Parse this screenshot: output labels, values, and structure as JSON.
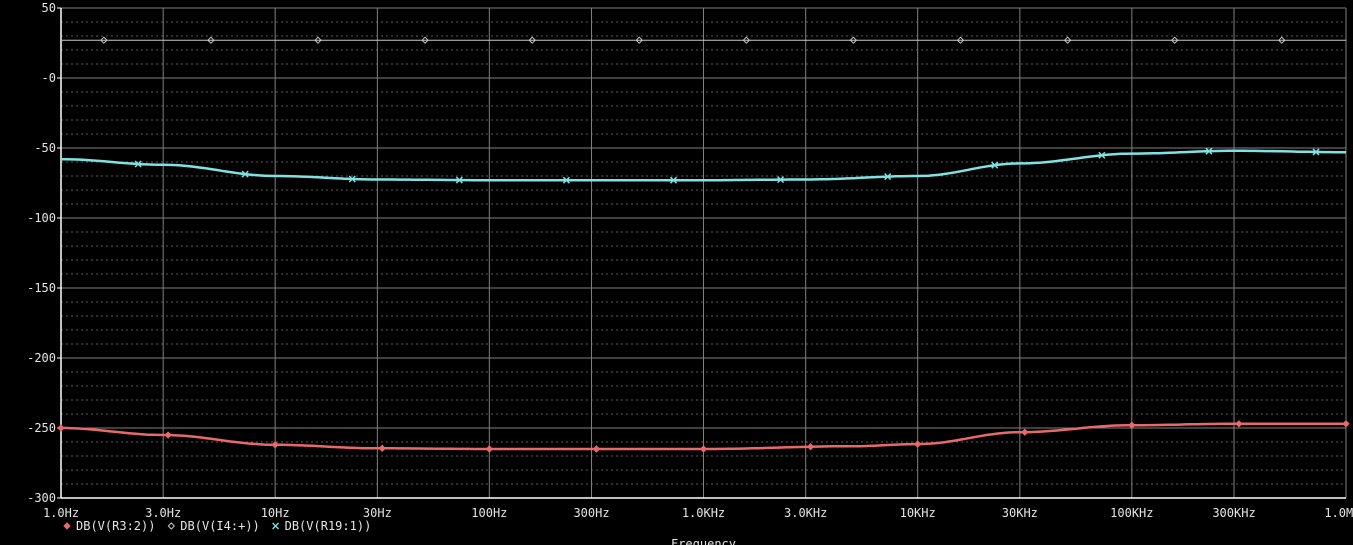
{
  "chart_data": {
    "type": "line",
    "xscale": "log",
    "xlabel": "Frequency",
    "ylabel": "",
    "xlim": [
      1,
      1000000
    ],
    "ylim": [
      -300,
      50
    ],
    "grid": true,
    "background": "#000000",
    "grid_color": "#808080",
    "axis_color": "#ffffff",
    "x_ticks": [
      {
        "value": 1,
        "label": "1.0Hz"
      },
      {
        "value": 3,
        "label": "3.0Hz"
      },
      {
        "value": 10,
        "label": "10Hz"
      },
      {
        "value": 30,
        "label": "30Hz"
      },
      {
        "value": 100,
        "label": "100Hz"
      },
      {
        "value": 300,
        "label": "300Hz"
      },
      {
        "value": 1000,
        "label": "1.0KHz"
      },
      {
        "value": 3000,
        "label": "3.0KHz"
      },
      {
        "value": 10000,
        "label": "10KHz"
      },
      {
        "value": 30000,
        "label": "30KHz"
      },
      {
        "value": 100000,
        "label": "100KHz"
      },
      {
        "value": 300000,
        "label": "300KHz"
      },
      {
        "value": 1000000,
        "label": "1.0MHz"
      }
    ],
    "y_ticks": [
      {
        "value": 50,
        "label": "50"
      },
      {
        "value": 0,
        "label": "-0"
      },
      {
        "value": -50,
        "label": "-50"
      },
      {
        "value": -100,
        "label": "-100"
      },
      {
        "value": -150,
        "label": "-150"
      },
      {
        "value": -200,
        "label": "-200"
      },
      {
        "value": -250,
        "label": "-250"
      },
      {
        "value": -300,
        "label": "-300"
      }
    ],
    "series": [
      {
        "name": "DB(V(R3:2))",
        "marker": "diamond",
        "color": "#e8696b",
        "x": [
          1,
          3,
          10,
          30,
          100,
          1000,
          5000,
          10000,
          30000,
          100000,
          300000,
          1000000
        ],
        "y": [
          -250,
          -255,
          -262,
          -264.5,
          -265,
          -265,
          -263,
          -261.5,
          -253,
          -248,
          -247,
          -247
        ]
      },
      {
        "name": "DB(V(I4:+))",
        "marker": "diamond",
        "color": "#c8c8c8",
        "x": [
          1,
          1000000
        ],
        "y": [
          27,
          27
        ]
      },
      {
        "name": "DB(V(R19:1))",
        "marker": "x",
        "color": "#7fe3e3",
        "x": [
          1,
          3,
          10,
          30,
          100,
          1000,
          3000,
          10000,
          30000,
          100000,
          300000,
          1000000
        ],
        "y": [
          -58,
          -62,
          -70,
          -72.5,
          -73,
          -73,
          -72.5,
          -70,
          -61,
          -54,
          -52,
          -53
        ]
      }
    ]
  }
}
